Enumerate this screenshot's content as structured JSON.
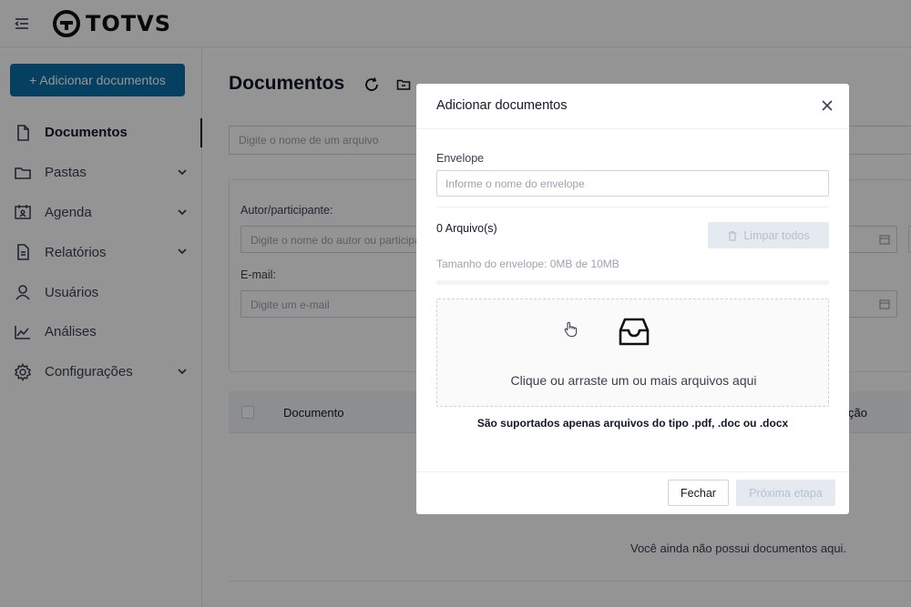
{
  "header": {
    "menu_icon": "menu-fold-icon",
    "logo_text": "TOTVS"
  },
  "sidebar": {
    "add_button": "+ Adicionar documentos",
    "items": [
      {
        "label": "Documentos",
        "icon": "file-icon",
        "active": true
      },
      {
        "label": "Pastas",
        "icon": "folder-icon",
        "expandable": true
      },
      {
        "label": "Agenda",
        "icon": "calendar-contact-icon",
        "expandable": true
      },
      {
        "label": "Relatórios",
        "icon": "report-icon",
        "expandable": true
      },
      {
        "label": "Usuários",
        "icon": "user-icon"
      },
      {
        "label": "Análises",
        "icon": "line-chart-icon"
      },
      {
        "label": "Configurações",
        "icon": "gear-icon",
        "expandable": true
      }
    ]
  },
  "main": {
    "title": "Documentos",
    "search_placeholder": "Digite o nome de um arquivo",
    "filters": {
      "author_label": "Autor/participante:",
      "author_placeholder": "Digite o nome do autor ou participante",
      "email_label": "E-mail:",
      "email_placeholder": "Digite um e-mail"
    },
    "table": {
      "col_document": "Documento",
      "col_right_fragment": "ção"
    },
    "empty_message": "Você ainda não possui documentos aqui."
  },
  "modal": {
    "title": "Adicionar documentos",
    "envelope_label": "Envelope",
    "envelope_placeholder": "Informe o nome do envelope",
    "files_count": "0 Arquivo(s)",
    "clear_all": "Limpar todos",
    "size_text": "Tamanho do envelope: 0MB de 10MB",
    "progress": 0,
    "drop_text": "Clique ou arraste um ou mais arquivos aqui",
    "support_text": "São suportados apenas arquivos do tipo .pdf, .doc ou .docx",
    "close_button": "Fechar",
    "next_button": "Próxima etapa"
  },
  "colors": {
    "primary": "#0b6ea8",
    "disabled_bg": "#e5eaf0",
    "disabled_text": "#b6c0cc"
  }
}
